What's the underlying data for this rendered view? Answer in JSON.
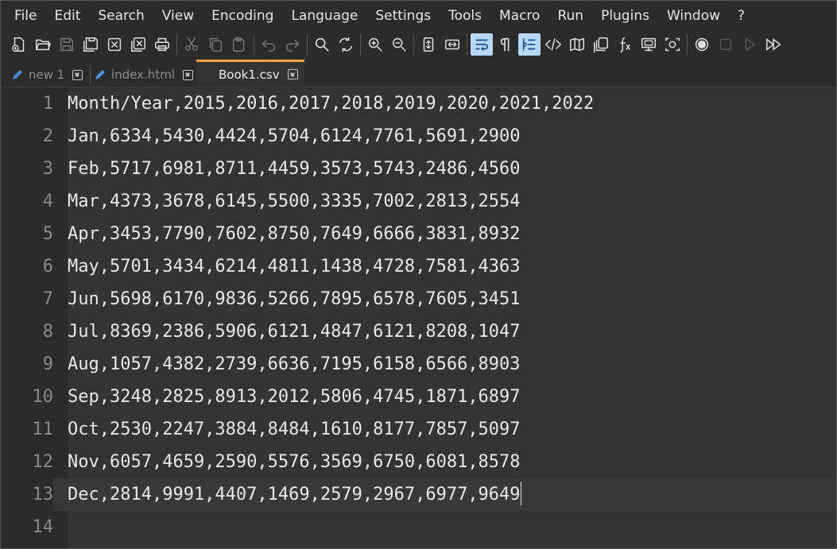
{
  "menu": [
    "File",
    "Edit",
    "Search",
    "View",
    "Encoding",
    "Language",
    "Settings",
    "Tools",
    "Macro",
    "Run",
    "Plugins",
    "Window",
    "?"
  ],
  "toolbar_icons": [
    "new-file-icon",
    "open-file-icon",
    "save-icon",
    "save-all-icon",
    "close-icon",
    "close-all-icon",
    "print-icon",
    "cut-icon",
    "copy-icon",
    "paste-icon",
    "undo-icon",
    "redo-icon",
    "find-icon",
    "replace-icon",
    "zoom-in-icon",
    "zoom-out-icon",
    "sync-vertical-icon",
    "sync-horizontal-icon",
    "word-wrap-icon",
    "show-all-chars-icon",
    "indent-guide-icon",
    "xml-tag-icon",
    "document-map-icon",
    "document-list-icon",
    "function-list-icon",
    "folder-workspace-icon",
    "monitor-icon",
    "record-macro-icon",
    "stop-record-icon",
    "play-macro-icon",
    "run-macro-multiple-icon"
  ],
  "tabs": [
    {
      "label": "new 1",
      "active": false
    },
    {
      "label": "index.html",
      "active": false
    },
    {
      "label": "Book1.csv",
      "active": true
    }
  ],
  "lines": [
    "Month/Year,2015,2016,2017,2018,2019,2020,2021,2022",
    "Jan,6334,5430,4424,5704,6124,7761,5691,2900",
    "Feb,5717,6981,8711,4459,3573,5743,2486,4560",
    "Mar,4373,3678,6145,5500,3335,7002,2813,2554",
    "Apr,3453,7790,7602,8750,7649,6666,3831,8932",
    "May,5701,3434,6214,4811,1438,4728,7581,4363",
    "Jun,5698,6170,9836,5266,7895,6578,7605,3451",
    "Jul,8369,2386,5906,6121,4847,6121,8208,1047",
    "Aug,1057,4382,2739,6636,7195,6158,6566,8903",
    "Sep,3248,2825,8913,2012,5806,4745,1871,6897",
    "Oct,2530,2247,3884,8484,1610,8177,7857,5097",
    "Nov,6057,4659,2590,5576,3569,6750,6081,8578",
    "Dec,2814,9991,4407,1469,2579,2967,6977,9649",
    ""
  ],
  "line_numbers": [
    "1",
    "2",
    "3",
    "4",
    "5",
    "6",
    "7",
    "8",
    "9",
    "10",
    "11",
    "12",
    "13",
    "14"
  ],
  "current_line": 13,
  "colors": {
    "accent": "#f0a040",
    "active_toggle": "#b7d7f5",
    "background": "#333333"
  }
}
